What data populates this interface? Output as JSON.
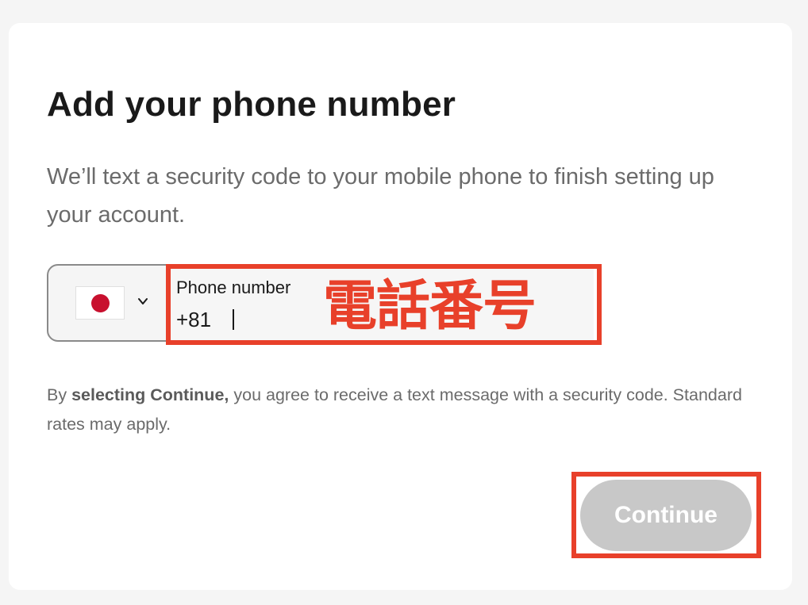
{
  "dialog": {
    "title": "Add your phone number",
    "subtitle": "We’ll text a security code to your mobile phone to finish setting up your account."
  },
  "country_select": {
    "selected_country_flag": "japan-flag",
    "flag_colors": {
      "field": "#ffffff",
      "disc": "#c8102e"
    },
    "dropdown_icon": "chevron-down-icon"
  },
  "phone_field": {
    "label": "Phone number",
    "country_code": "+81",
    "value": ""
  },
  "annotation": {
    "text": "電話番号",
    "color": "#e8402a"
  },
  "legal": {
    "prefix": "By ",
    "bold": "selecting Continue,",
    "suffix": " you agree to receive a text message with a security code. Standard rates may apply."
  },
  "actions": {
    "continue_label": "Continue",
    "continue_state": "disabled"
  },
  "colors": {
    "page_background": "#f5f5f5",
    "card_background": "#ffffff",
    "button_disabled": "#c8c8c8",
    "highlight": "#e8402a"
  }
}
